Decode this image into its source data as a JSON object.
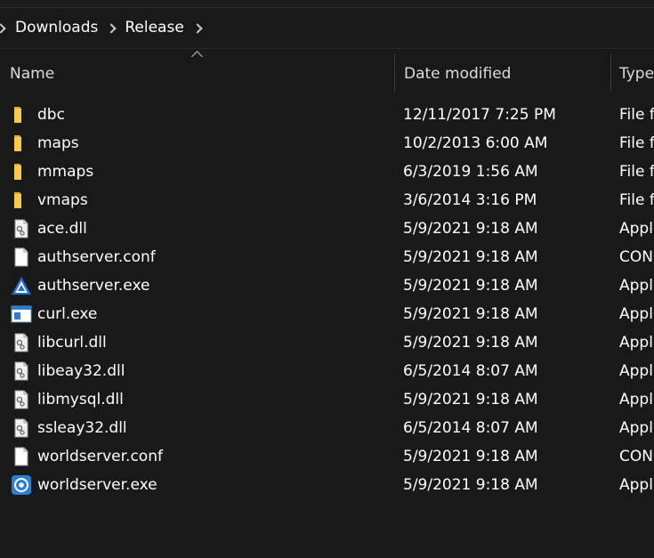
{
  "breadcrumb": {
    "items": [
      "Downloads",
      "Release"
    ]
  },
  "columns": {
    "name": "Name",
    "date_modified": "Date modified",
    "type": "Type"
  },
  "files": [
    {
      "name": "dbc",
      "date": "12/11/2017 7:25 PM",
      "type": "File folder",
      "icon": "folder-icon"
    },
    {
      "name": "maps",
      "date": "10/2/2013 6:00 AM",
      "type": "File folder",
      "icon": "folder-icon"
    },
    {
      "name": "mmaps",
      "date": "6/3/2019 1:56 AM",
      "type": "File folder",
      "icon": "folder-icon"
    },
    {
      "name": "vmaps",
      "date": "3/6/2014 3:16 PM",
      "type": "File folder",
      "icon": "folder-icon"
    },
    {
      "name": "ace.dll",
      "date": "5/9/2021 9:18 AM",
      "type": "Application extension",
      "icon": "dll-file-icon"
    },
    {
      "name": "authserver.conf",
      "date": "5/9/2021 9:18 AM",
      "type": "CONF File",
      "icon": "blank-file-icon"
    },
    {
      "name": "authserver.exe",
      "date": "5/9/2021 9:18 AM",
      "type": "Application",
      "icon": "authserver-app-icon"
    },
    {
      "name": "curl.exe",
      "date": "5/9/2021 9:18 AM",
      "type": "Application",
      "icon": "window-app-icon"
    },
    {
      "name": "libcurl.dll",
      "date": "5/9/2021 9:18 AM",
      "type": "Application extension",
      "icon": "dll-file-icon"
    },
    {
      "name": "libeay32.dll",
      "date": "6/5/2014 8:07 AM",
      "type": "Application extension",
      "icon": "dll-file-icon"
    },
    {
      "name": "libmysql.dll",
      "date": "5/9/2021 9:18 AM",
      "type": "Application extension",
      "icon": "dll-file-icon"
    },
    {
      "name": "ssleay32.dll",
      "date": "6/5/2014 8:07 AM",
      "type": "Application extension",
      "icon": "dll-file-icon"
    },
    {
      "name": "worldserver.conf",
      "date": "5/9/2021 9:18 AM",
      "type": "CONF File",
      "icon": "blank-file-icon"
    },
    {
      "name": "worldserver.exe",
      "date": "5/9/2021 9:18 AM",
      "type": "Application",
      "icon": "worldserver-app-icon"
    }
  ],
  "colors": {
    "background": "#191919",
    "folder": "#f7c948",
    "text": "#ffffff",
    "accent": "#1e6fd0"
  }
}
